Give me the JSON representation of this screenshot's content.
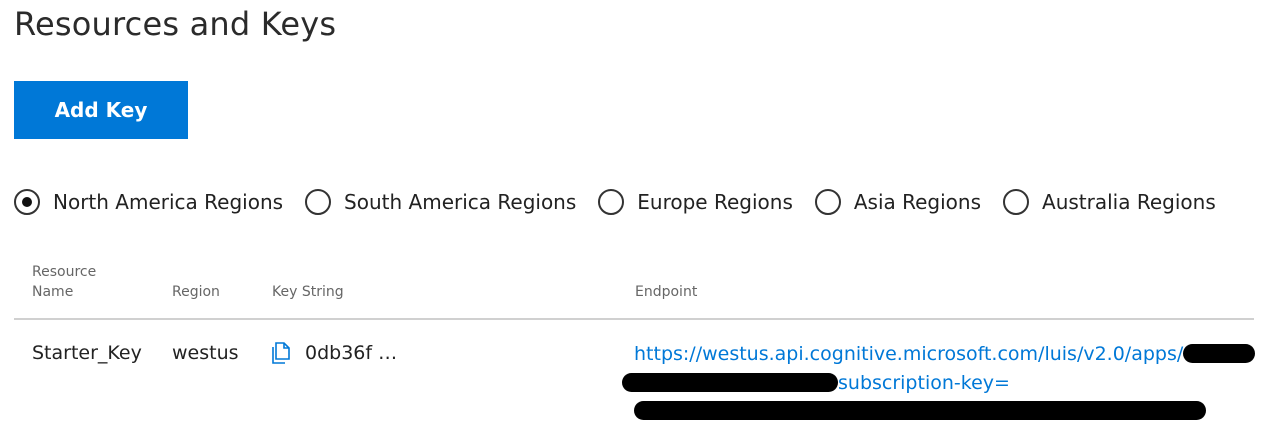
{
  "page": {
    "title": "Resources and Keys"
  },
  "toolbar": {
    "add_key_label": "Add Key"
  },
  "regions": {
    "options": [
      {
        "label": "North America Regions",
        "checked": true
      },
      {
        "label": "South America Regions",
        "checked": false
      },
      {
        "label": "Europe Regions",
        "checked": false
      },
      {
        "label": "Asia Regions",
        "checked": false
      },
      {
        "label": "Australia Regions",
        "checked": false
      }
    ]
  },
  "table": {
    "headers": {
      "resource_name": "Resource Name",
      "region": "Region",
      "key_string": "Key String",
      "endpoint": "Endpoint"
    },
    "rows": [
      {
        "resource_name": "Starter_Key",
        "region": "westus",
        "key_string": "0db36f …",
        "endpoint_prefix": "https://westus.api.cognitive.microsoft.com/luis/v2.0/apps/",
        "endpoint_middle": "subscription-key="
      }
    ]
  },
  "icons": {
    "copy": "copy-icon",
    "radio_checked": "radio-checked-icon",
    "radio_unchecked": "radio-unchecked-icon"
  },
  "colors": {
    "accent": "#0078d7",
    "text": "#222222",
    "header_text": "#666666",
    "divider": "#d0d0d0"
  }
}
